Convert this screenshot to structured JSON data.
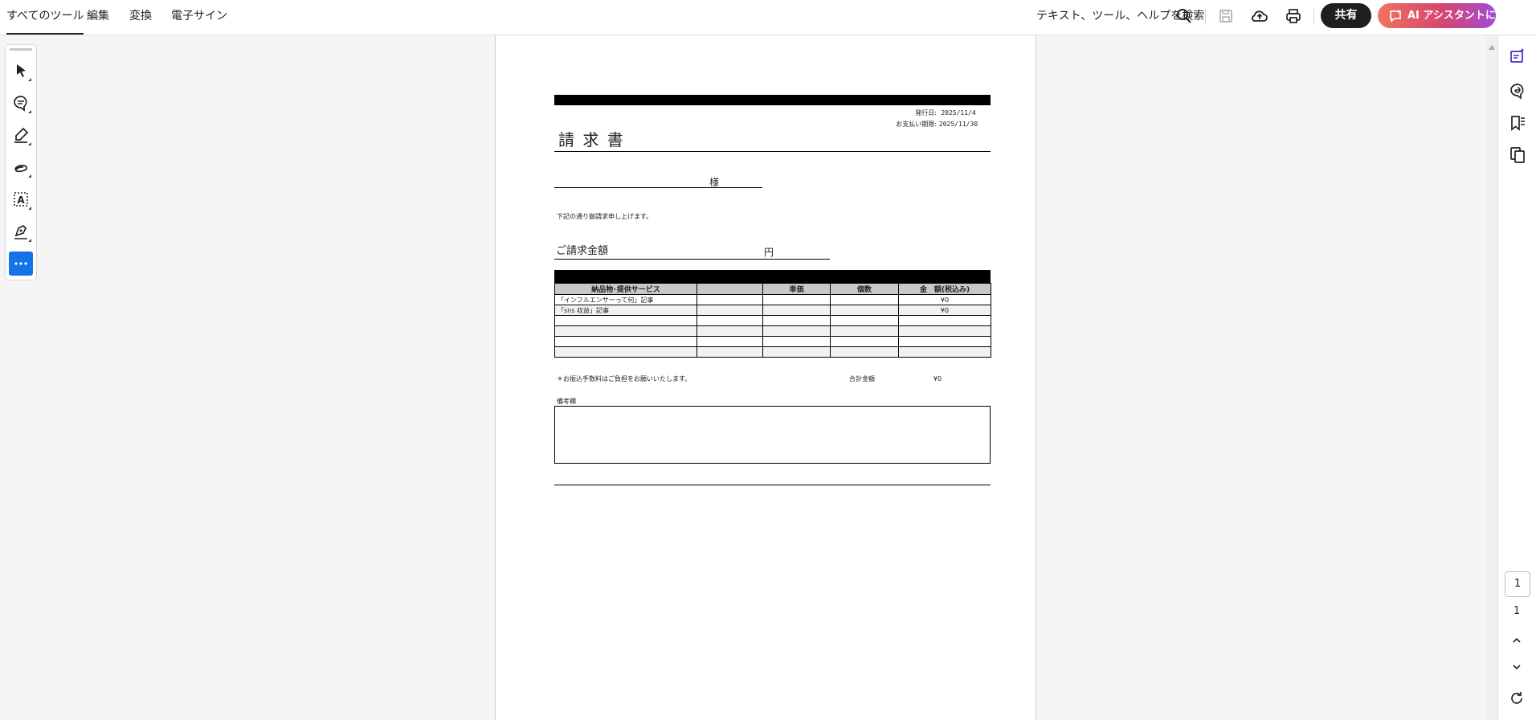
{
  "top_menu": {
    "all_tools": "すべてのツール",
    "edit": "編集",
    "convert": "変換",
    "e_sign": "電子サイン"
  },
  "search": {
    "label": "テキスト、ツール、ヘルプを検索"
  },
  "share_label": "共有",
  "ai_assistant_label": "AI アシスタントに質問",
  "document": {
    "issue_date_label": "発行日:",
    "issue_date": "2025/11/4",
    "due_date_label": "お支払い期限:",
    "due_date": "2025/11/30",
    "title": "請 求 書",
    "customer_suffix": "様",
    "intro": "下記の通り御請求申し上げます。",
    "amount_label": "ご請求金額",
    "yen": "円",
    "table": {
      "headers": [
        "納品物･提供サービス",
        "",
        "単価",
        "個数",
        "金　額(税込み)"
      ],
      "rows": [
        [
          "「インフルエンサーって何」記事",
          "",
          "",
          "",
          "¥0"
        ],
        [
          "「sns 収益」記事",
          "",
          "",
          "",
          "¥0"
        ],
        [
          "",
          "",
          "",
          "",
          ""
        ],
        [
          "",
          "",
          "",
          "",
          ""
        ],
        [
          "",
          "",
          "",
          "",
          ""
        ],
        [
          "",
          "",
          "",
          "",
          ""
        ]
      ]
    },
    "fee_note": "＊お振込手数料はご負担をお願いいたします。",
    "total_label": "合計金額",
    "total_value": "¥0",
    "remarks_label": "備考欄"
  },
  "pagination": {
    "current": "1",
    "total": "1"
  },
  "colors": {
    "accent_blue": "#1473e6",
    "share_bg": "#1f1f1f",
    "ai_gradient_start": "#f07360",
    "ai_gradient_end": "#a24ad6"
  }
}
